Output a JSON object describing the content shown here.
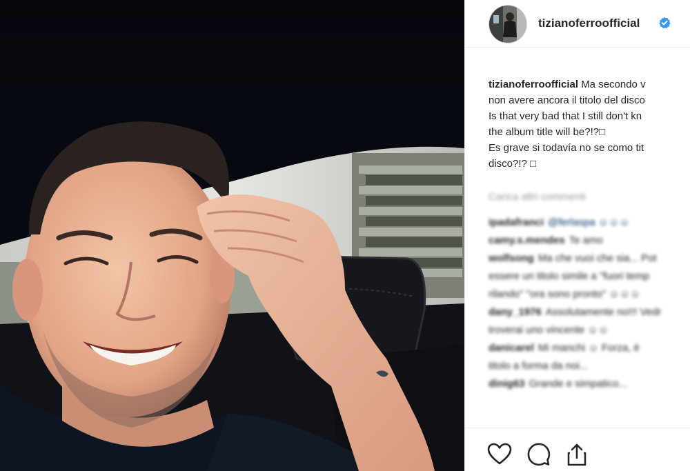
{
  "post": {
    "username": "tizianoferroofficial",
    "verified": true,
    "caption_author": "tizianoferroofficial",
    "caption_lines": [
      "Ma secondo v",
      "non avere ancora il titolo del disco",
      "Is that very bad that I still don't kn",
      "the album title will be?!?□",
      "Es grave si todavía no se como tit",
      "disco?!? □"
    ]
  },
  "comments_section": {
    "load_more": "Carica altri commenti",
    "comments": [
      {
        "author": "ipadafranci",
        "text": "@ferlaspa ☺☺☺"
      },
      {
        "author": "camy.s.mendes",
        "text": "Te amo"
      },
      {
        "author": "wolfsong",
        "text": "Ma che vuoi che sia... Pot"
      },
      {
        "author": "",
        "text": "essere un titolo simile a \"fuori temp"
      },
      {
        "author": "",
        "text": "rilando\" \"ora sono pronto\" ☺☺☺"
      },
      {
        "author": "dany_1976",
        "text": "Assolutamente no!!! Vedr"
      },
      {
        "author": "",
        "text": "troverai uno vincente ☺☺"
      },
      {
        "author": "danicarel",
        "text": "Mi manchi ☺ Forza, è"
      },
      {
        "author": "",
        "text": "titolo a forma da noi..."
      },
      {
        "author": "dinig63",
        "text": "Grande e simpatico..."
      }
    ]
  },
  "actions": {
    "like": "heart-icon",
    "comment": "comment-bubble-icon",
    "share": "share-icon"
  },
  "colors": {
    "verified_badge": "#3897f0",
    "text_primary": "#262626",
    "border": "#efefef"
  }
}
